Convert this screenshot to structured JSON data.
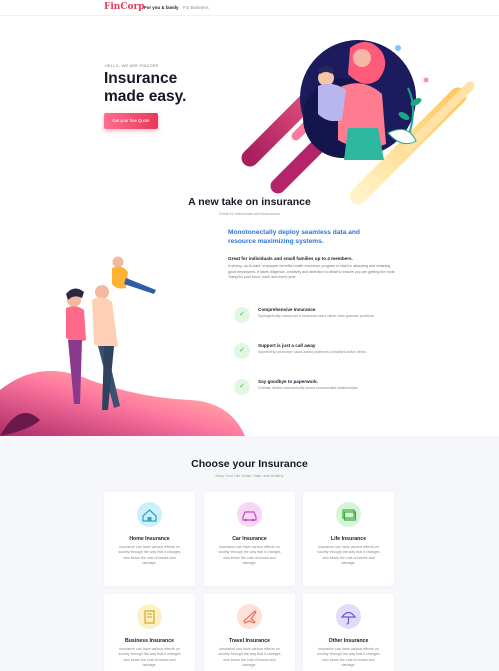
{
  "nav": {
    "logo": "FinCorp",
    "links": [
      "For you & family",
      "For Business"
    ]
  },
  "hero": {
    "kicker": "HELLO, WE ARE FINCORP",
    "title_line1": "Insurance",
    "title_line2": "made easy.",
    "cta": "Get your free Quote"
  },
  "about": {
    "title": "A new take on insurance",
    "subtitle": "Great for individuals and businesses",
    "headline": "Monotonectally deploy seamless data and resource maximizing systems.",
    "bold_line": "Great for individuals and small families up to 4 members.",
    "paragraph": "A strong, up-to-date, employee benefits health insurance program is vital for attracting and retaining good employees. It takes diligence, creativity and attention to detail to ensure you are getting the most \"bang for your buck\" each and every year.",
    "features": [
      {
        "title": "Comprehensive Insurance",
        "text": "Synergistically repurpose e-business users rather than granular products."
      },
      {
        "title": "Support is just a call away",
        "text": "Assertively customize value-added platforms compliant action items."
      },
      {
        "title": "Say goodbye to paperwork.",
        "text": "Globally deliver economically sound communities relationships."
      }
    ]
  },
  "choose": {
    "title": "Choose your Insurance",
    "subtitle": "Keep Your Life Goals, Safe, and Healthy",
    "cards": [
      {
        "title": "Home Insurance",
        "text": "Insurance can have various effects on society through the way that it changes who bears the cost of losses and damage."
      },
      {
        "title": "Car Insurance",
        "text": "Insurance can have various effects on society through the way that it changes who bears the cost of losses and damage."
      },
      {
        "title": "Life Insurance",
        "text": "Insurance can have various effects on society through the way that it changes who bears the cost of losses and damage."
      },
      {
        "title": "Business Insurance",
        "text": "Insurance can have various effects on society through the way that it changes who bears the cost of losses and damage."
      },
      {
        "title": "Travel Insurance",
        "text": "Insurance can have various effects on society through the way that it changes who bears the cost of losses and damage."
      },
      {
        "title": "Other Insurance",
        "text": "Insurance can have various effects on society through the way that it changes who bears the cost of losses and damage."
      }
    ],
    "icons": [
      "home-shield-icon",
      "car-icon",
      "life-cash-icon",
      "business-building-icon",
      "airplane-icon",
      "umbrella-icon"
    ]
  },
  "colors": {
    "brand": "#e8385a",
    "accent_blue": "#2d73d8",
    "check_green": "#4cb04c"
  }
}
